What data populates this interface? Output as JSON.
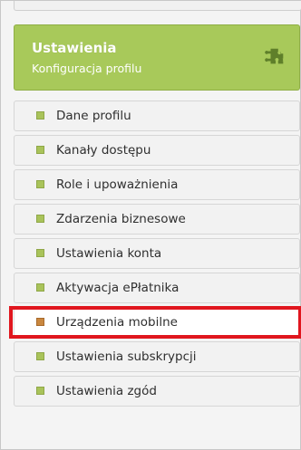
{
  "header": {
    "title": "Ustawienia",
    "subtitle": "Konfiguracja profilu",
    "icon": "puzzle-icon",
    "color": "#a8c95a"
  },
  "menu": {
    "items": [
      {
        "label": "Dane profilu"
      },
      {
        "label": "Kanały dostępu"
      },
      {
        "label": "Role i upoważnienia"
      },
      {
        "label": "Zdarzenia biznesowe"
      },
      {
        "label": "Ustawienia konta"
      },
      {
        "label": "Aktywacja ePłatnika"
      },
      {
        "label": "Urządzenia mobilne",
        "active": true
      },
      {
        "label": "Ustawienia subskrypcji"
      },
      {
        "label": "Ustawienia zgód"
      }
    ]
  },
  "highlight": {
    "color": "#e0161e"
  }
}
